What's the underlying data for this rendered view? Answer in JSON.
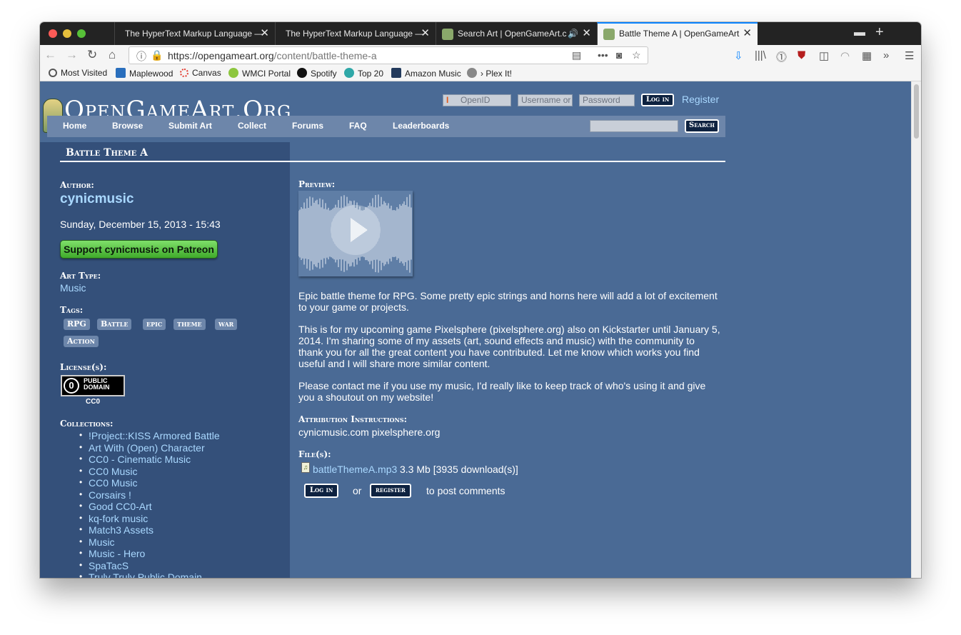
{
  "browser": {
    "tabs": [
      {
        "title": "The HyperText Markup Language —"
      },
      {
        "title": "The HyperText Markup Language —"
      },
      {
        "title": "Search Art | OpenGameArt.c"
      },
      {
        "title": "Battle Theme A | OpenGameArt"
      }
    ],
    "url_host": "https://opengameart.org",
    "url_path": "/content/battle-theme-a",
    "bookmarks": [
      "Most Visited",
      "Maplewood",
      "Canvas",
      "WMCI Portal",
      "Spotify",
      "Top 20",
      "Amazon Music",
      "› Plex It!"
    ]
  },
  "site": {
    "logo": "OpenGameArt.Org",
    "login": {
      "openid": "OpenID",
      "username_placeholder": "Username or",
      "password_placeholder": "Password",
      "login_button": "Log in",
      "register": "Register"
    },
    "menu": [
      "Home",
      "Browse",
      "Submit Art",
      "Collect",
      "Forums",
      "FAQ",
      "Leaderboards"
    ],
    "search_button": "Search"
  },
  "content": {
    "title": "Battle Theme A",
    "author_label": "Author:",
    "author": "cynicmusic",
    "date": "Sunday, December 15, 2013 - 15:43",
    "patreon": "Support cynicmusic on Patreon",
    "art_type_label": "Art Type:",
    "art_type": "Music",
    "tags_label": "Tags:",
    "tags": [
      "RPG",
      "Battle",
      "epic",
      "theme",
      "war",
      "Action"
    ],
    "license_label": "License(s):",
    "license_badge": {
      "symbol": "0",
      "line1": "PUBLIC",
      "line2": "DOMAIN"
    },
    "license_name": "CC0",
    "collections_label": "Collections:",
    "collections": [
      "!Project::KISS Armored Battle",
      "Art With (Open) Character",
      "CC0 - Cinematic Music",
      "CC0 Music",
      "CC0 Music",
      "Corsairs !",
      "Good CC0-Art",
      "kq-fork music",
      "Match3 Assets",
      "Music",
      "Music - Hero",
      "SpaTacS",
      "Truly Truly Public Domain"
    ],
    "preview_label": "Preview:",
    "description": [
      "Epic battle theme for RPG. Some pretty epic strings and horns here will add a lot of excitement to your game or projects.",
      "This is for my upcoming game Pixelsphere (pixelsphere.org) also on Kickstarter until January 5, 2014. I'm sharing some of my assets (art, sound effects and music) with the community to thank you for all the great content you have contributed. Let me know which works you find useful and I will share more similar content.",
      "Please contact me if you use my music, I'd really like to keep track of who's using it and give you a shoutout on my website!"
    ],
    "attribution_label": "Attribution Instructions:",
    "attribution": "cynicmusic.com pixelsphere.org",
    "files_label": "File(s):",
    "file_name": "battleThemeA.mp3",
    "file_info": "3.3 Mb [3935 download(s)]",
    "comment": {
      "login": "Log in",
      "or": "or",
      "register": "register",
      "suffix": "to post comments"
    }
  }
}
